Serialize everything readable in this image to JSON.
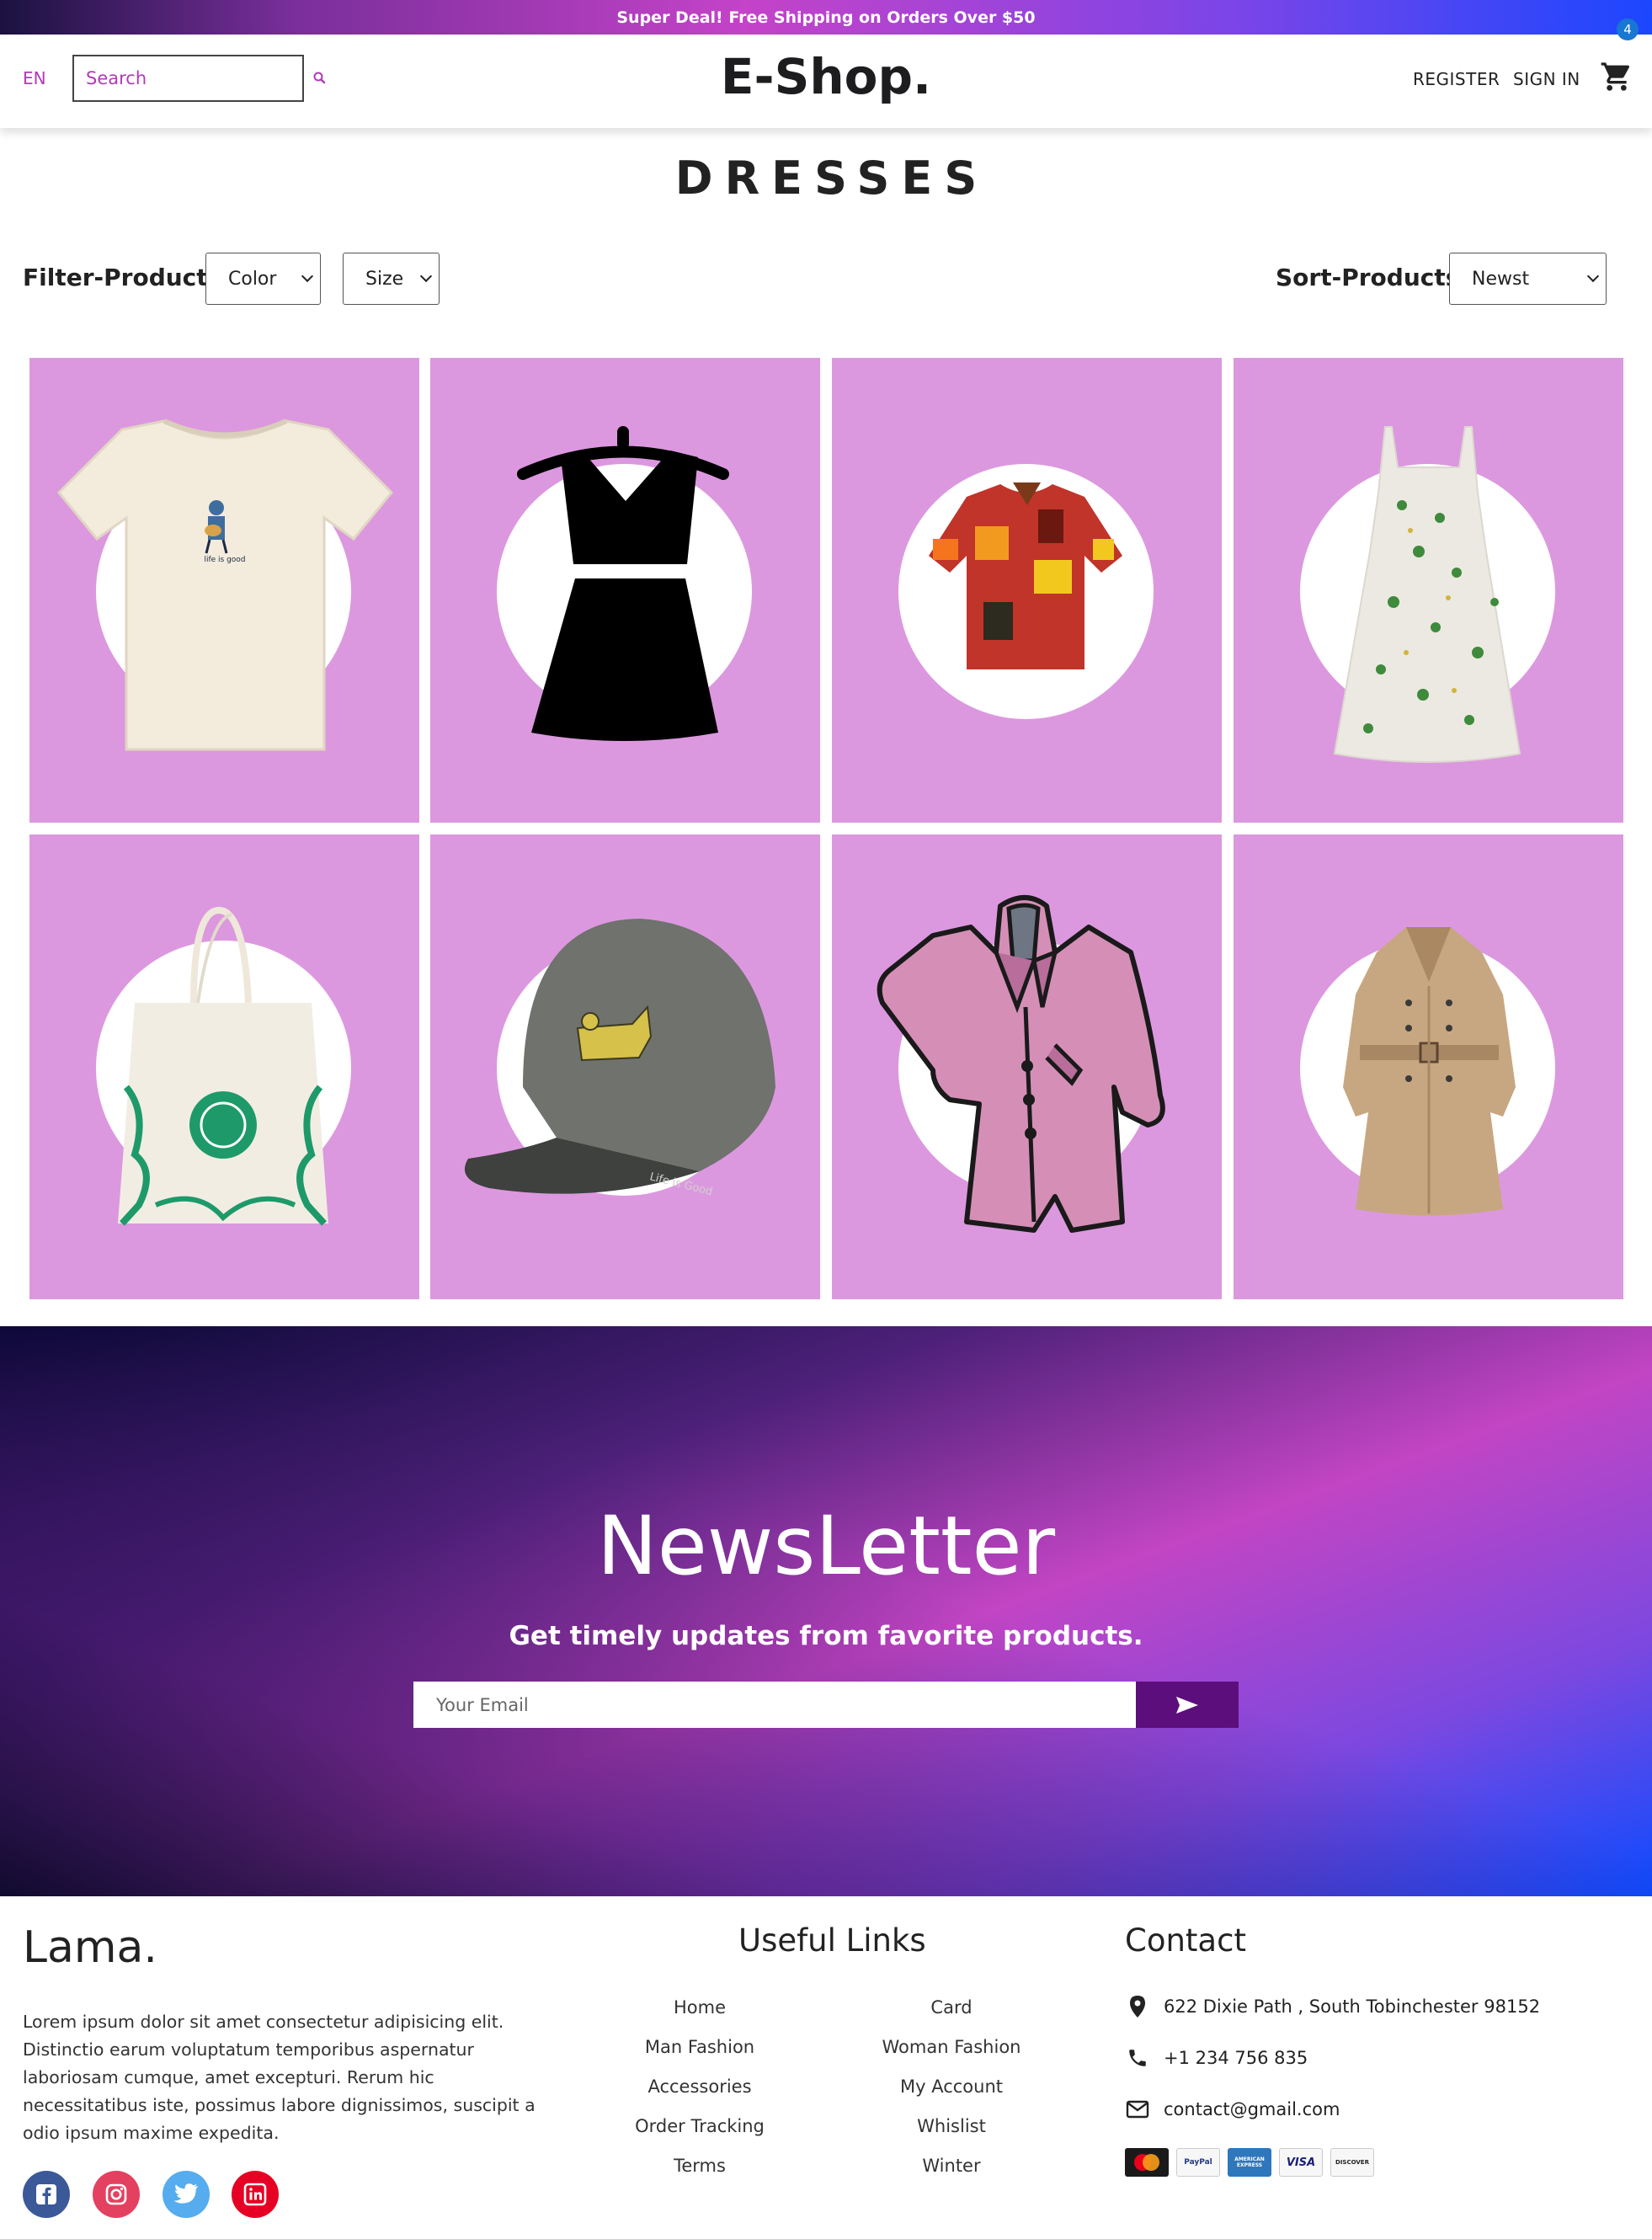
{
  "announcement": "Super Deal! Free Shipping on Orders Over $50",
  "navbar": {
    "lang": "EN",
    "search_placeholder": "Search",
    "logo": "E-Shop.",
    "register": "REGISTER",
    "signin": "SIGN IN",
    "cart_count": "4"
  },
  "page_title": "DRESSES",
  "filters": {
    "filter_label": "Filter-Products:",
    "color": "Color",
    "size": "Size",
    "sort_label": "Sort-Products:",
    "sort": "Newst"
  },
  "products": [
    {
      "icon": "tshirt"
    },
    {
      "icon": "black-dress"
    },
    {
      "icon": "hawaiian-shirt"
    },
    {
      "icon": "floral-dress"
    },
    {
      "icon": "tote-bag"
    },
    {
      "icon": "cap"
    },
    {
      "icon": "pink-coat"
    },
    {
      "icon": "trench-coat"
    }
  ],
  "newsletter": {
    "title": "NewsLetter",
    "subtitle": "Get timely updates from favorite products.",
    "placeholder": "Your Email"
  },
  "footer": {
    "logo": "Lama.",
    "description": "Lorem ipsum dolor sit amet consectetur adipisicing elit. Distinctio earum voluptatum temporibus aspernatur laboriosam cumque, amet excepturi. Rerum hic necessitatibus iste, possimus labore dignissimos, suscipit a odio ipsum maxime expedita.",
    "social": [
      "facebook",
      "instagram",
      "twitter",
      "linkedin"
    ],
    "useful_links_title": "Useful Links",
    "links_left": [
      "Home",
      "Man Fashion",
      "Accessories",
      "Order Tracking",
      "Terms"
    ],
    "links_right": [
      "Card",
      "Woman Fashion",
      "My Account",
      "Whislist",
      "Winter"
    ],
    "contact_title": "Contact",
    "address": "622 Dixie Path , South Tobinchester 98152",
    "phone": "+1 234 756 835",
    "email": "contact@gmail.com",
    "payments": [
      "MasterCard",
      "PayPal",
      "AMERICAN EXPRESS",
      "VISA",
      "DISCOVER"
    ]
  },
  "colors": {
    "product_bg": "#dc98df",
    "accent": "#b03bb8",
    "send_button": "#5c0f7c",
    "cart_badge": "#1976d2"
  }
}
